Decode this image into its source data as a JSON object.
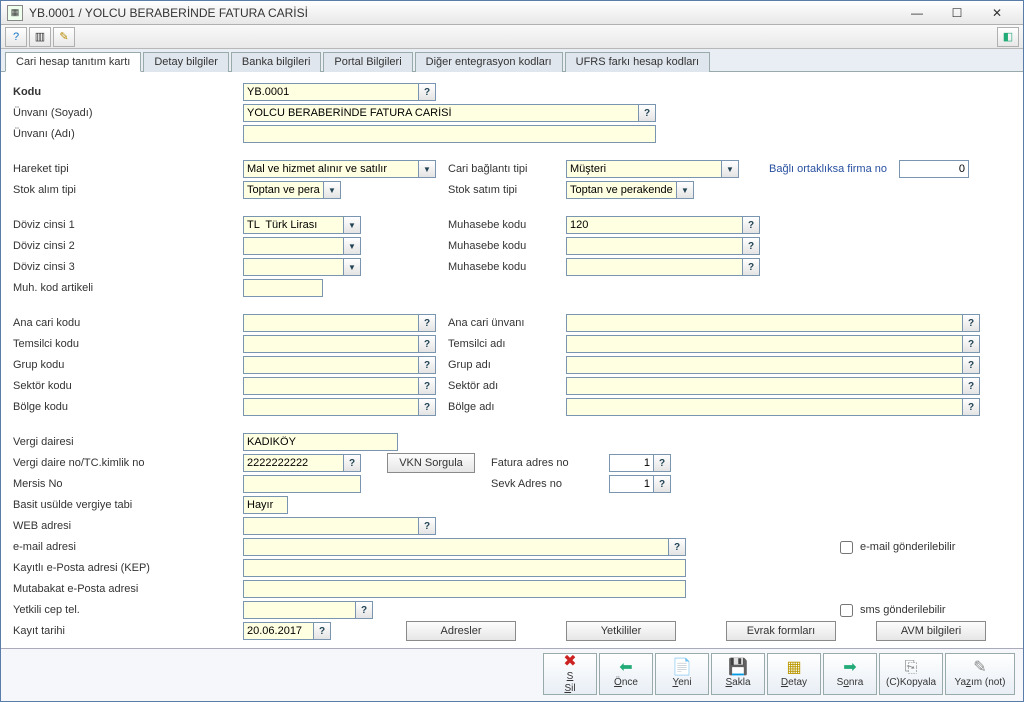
{
  "window": {
    "title": "YB.0001 / YOLCU BERABERİNDE FATURA CARİSİ"
  },
  "tabs": {
    "list": [
      "Cari hesap tanıtım kartı",
      "Detay bilgiler",
      "Banka bilgileri",
      "Portal Bilgileri",
      "Diğer entegrasyon kodları",
      "UFRS farkı hesap kodları"
    ]
  },
  "labels": {
    "kodu": "Kodu",
    "unvaniSoyadi": "Ünvanı (Soyadı)",
    "unvaniAdi": "Ünvanı (Adı)",
    "hareketTipi": "Hareket tipi",
    "stokAlimTipi": "Stok alım tipi",
    "cariBaglantiTipi": "Cari bağlantı tipi",
    "stokSatimTipi": "Stok satım tipi",
    "bagliFirmaNo": "Bağlı ortaklıksa firma no",
    "doviz1": "Döviz cinsi 1",
    "doviz2": "Döviz cinsi 2",
    "doviz3": "Döviz cinsi 3",
    "muhKodArtikeli": "Muh. kod artikeli",
    "muhasebeKodu": "Muhasebe kodu",
    "anaCariKodu": "Ana cari kodu",
    "anaCariUnvani": "Ana cari ünvanı",
    "temsilciKodu": "Temsilci kodu",
    "temsilciAdi": "Temsilci adı",
    "grupKodu": "Grup kodu",
    "grupAdi": "Grup adı",
    "sektorKodu": "Sektör kodu",
    "sektorAdi": "Sektör adı",
    "bolgeKodu": "Bölge kodu",
    "bolgeAdi": "Bölge adı",
    "vergiDairesi": "Vergi dairesi",
    "vergiNo": "Vergi daire no/TC.kimlik no",
    "mersisNo": "Mersis No",
    "basitUsul": "Basit usülde vergiye tabi",
    "webAdresi": "WEB adresi",
    "emailAdresi": "e-mail adresi",
    "kep": "Kayıtlı e-Posta adresi (KEP)",
    "mutabakat": "Mutabakat e-Posta adresi",
    "yetkiliCep": "Yetkili cep tel.",
    "kayitTarihi": "Kayıt tarihi",
    "faturaAdresNo": "Fatura adres no",
    "sevkAdresNo": "Sevk Adres no",
    "emailGonder": "e-mail gönderilebilir",
    "smsGonder": "sms gönderilebilir"
  },
  "buttons": {
    "vknSorgula": "VKN Sorgula",
    "adresler": "Adresler",
    "yetkililer": "Yetkililer",
    "evrakFormlari": "Evrak formları",
    "avmBilgileri": "AVM bilgileri"
  },
  "values": {
    "kodu": "YB.0001",
    "unvaniSoyadi": "YOLCU BERABERİNDE FATURA CARİSİ",
    "unvaniAdi": "",
    "hareketTipi": "Mal ve hizmet alınır ve satılır",
    "stokAlimTipi": "Toptan ve perakende",
    "cariBaglantiTipi": "Müşteri",
    "stokSatimTipi": "Toptan ve perakende",
    "bagliFirmaNo": "0",
    "doviz1": "TL  Türk Lirası",
    "doviz2": "",
    "doviz3": "",
    "muhKodArtikeli": "",
    "muhasebeKodu1": "120",
    "muhasebeKodu2": "",
    "muhasebeKodu3": "",
    "anaCariKodu": "",
    "anaCariUnvani": "",
    "temsilciKodu": "",
    "temsilciAdi": "",
    "grupKodu": "",
    "grupAdi": "",
    "sektorKodu": "",
    "sektorAdi": "",
    "bolgeKodu": "",
    "bolgeAdi": "",
    "vergiDairesi": "KADIKÖY",
    "vergiNo": "2222222222",
    "mersisNo": "",
    "basitUsul": "Hayır",
    "webAdresi": "",
    "emailAdresi": "",
    "kep": "",
    "mutabakat": "",
    "yetkiliCep": "",
    "kayitTarihi": "20.06.2017",
    "faturaAdresNo": "1",
    "sevkAdresNo": "1"
  },
  "bottom": {
    "sil": "Sil",
    "once": "Önce",
    "yeni": "Yeni",
    "sakla": "Sakla",
    "detay": "Detay",
    "sonra": "Sonra",
    "kopyala": "(C)Kopyala",
    "yazim": "Yazım (not)"
  }
}
